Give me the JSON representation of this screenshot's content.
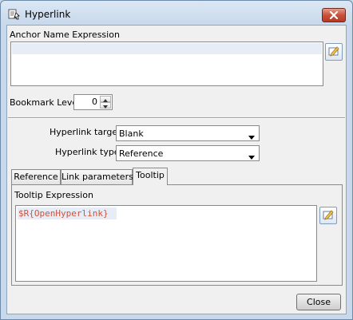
{
  "window": {
    "title": "Hyperlink",
    "icon": "hyperlink-app-icon",
    "close_icon": "close-icon"
  },
  "anchor": {
    "label": "Anchor Name Expression",
    "value": "",
    "editor_icon": "expression-editor-icon"
  },
  "bookmark": {
    "label": "Bookmark Level",
    "value": "0"
  },
  "hyperlink_target": {
    "label": "Hyperlink target",
    "value": "Blank"
  },
  "hyperlink_type": {
    "label": "Hyperlink type",
    "value": "Reference"
  },
  "tabs": [
    {
      "label": "Reference",
      "active": false
    },
    {
      "label": "Link parameters",
      "active": false
    },
    {
      "label": "Tooltip",
      "active": true
    }
  ],
  "tooltip": {
    "label": "Tooltip Expression",
    "value": "$R{OpenHyperlink}",
    "editor_icon": "expression-editor-icon"
  },
  "footer": {
    "close_label": "Close"
  },
  "colors": {
    "title_bar": "#c8d9ec",
    "close_button": "#c8513c",
    "expression_text": "#c8553d",
    "selection": "#e6edf7"
  }
}
